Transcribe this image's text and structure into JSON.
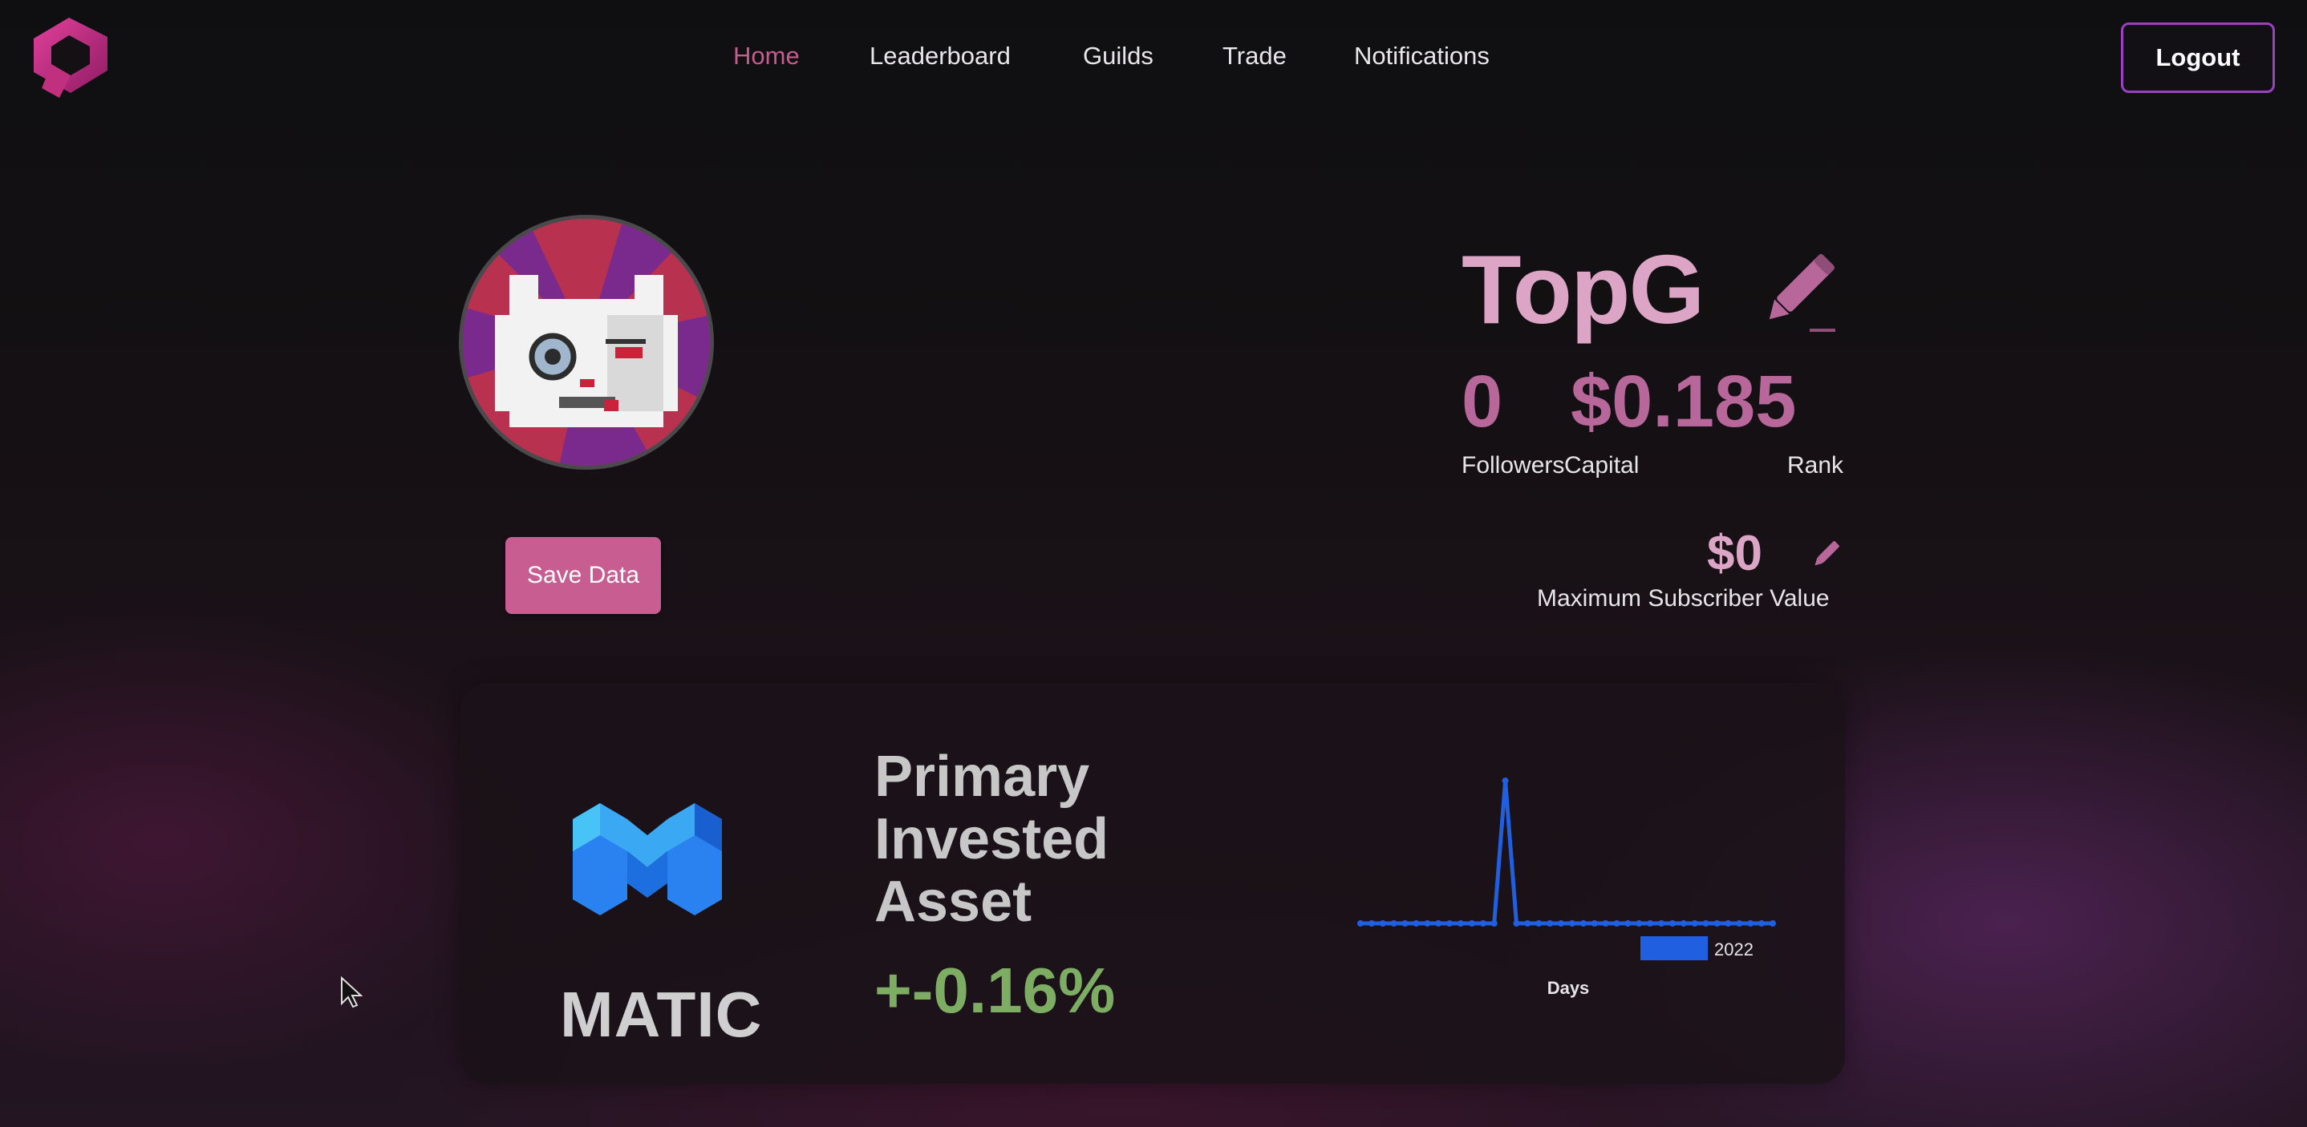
{
  "nav": {
    "items": [
      "Home",
      "Leaderboard",
      "Guilds",
      "Trade",
      "Notifications"
    ],
    "active": "Home",
    "logout_label": "Logout"
  },
  "profile": {
    "username": "TopG",
    "followers_value": "0",
    "followers_label": "Followers",
    "capital_value": "$0.185",
    "capital_label": "Capital",
    "rank_label": "Rank",
    "max_subscriber_value": "$0",
    "max_subscriber_label": "Maximum Subscriber Value",
    "save_label": "Save Data"
  },
  "asset": {
    "symbol": "MATIC",
    "title_lines": [
      "Primary",
      "Invested",
      "Asset"
    ],
    "change": "+-0.16%"
  },
  "chart_data": {
    "type": "line",
    "xlabel": "Days",
    "legend": [
      "2022"
    ],
    "legend_placement": "bottom-right",
    "series": [
      {
        "name": "2022",
        "values": [
          0,
          0,
          0,
          0,
          0,
          0,
          0,
          0,
          0,
          0,
          0,
          0,
          0,
          1,
          0,
          0,
          0,
          0,
          0,
          0,
          0,
          0,
          0,
          0,
          0,
          0,
          0,
          0,
          0,
          0,
          0,
          0,
          0,
          0,
          0,
          0,
          0,
          0
        ]
      }
    ],
    "color": "#1f5fe0",
    "grid": false
  },
  "colors": {
    "accent_pink": "#c65b8f",
    "username": "#dca5c6",
    "stat": "#b8679a",
    "logout_border": "#9b3fc3",
    "positive": "#7cad62",
    "chart_line": "#1f5fe0"
  },
  "icons": {
    "logo": "brand-logo-icon",
    "edit": "pencil-icon",
    "asset": "matic-logo-icon",
    "pointer": "cursor-icon"
  }
}
